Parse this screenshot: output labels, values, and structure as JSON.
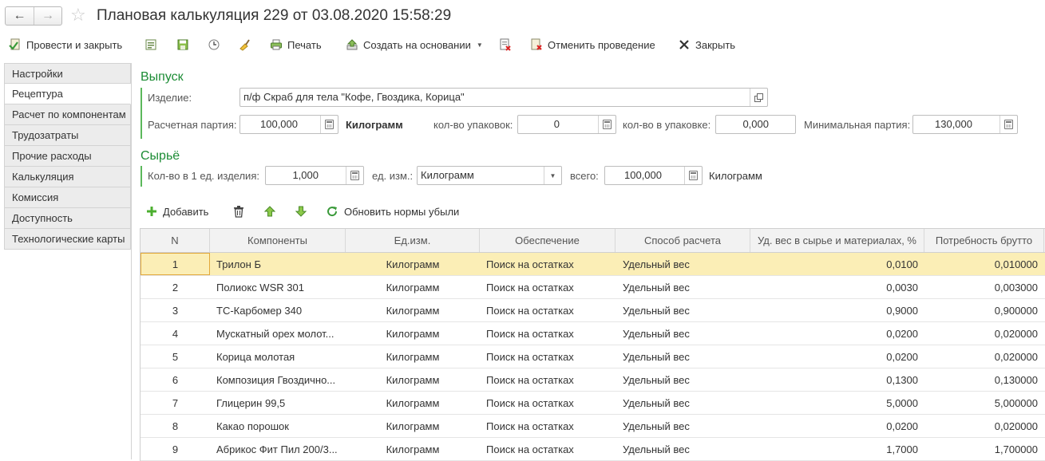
{
  "window": {
    "title": "Плановая калькуляция 229 от 03.08.2020 15:58:29",
    "back_glyph": "←",
    "forward_glyph": "→",
    "star_glyph": "☆"
  },
  "toolbar": {
    "post_close": "Провести и закрыть",
    "print": "Печать",
    "create_based": "Создать на основании",
    "cancel_post": "Отменить проведение",
    "close": "Закрыть"
  },
  "sidenav": {
    "items": [
      {
        "label": "Настройки",
        "active": false
      },
      {
        "label": "Рецептура",
        "active": true
      },
      {
        "label": "Расчет по компонентам",
        "active": false
      },
      {
        "label": "Трудозатраты",
        "active": false
      },
      {
        "label": "Прочие расходы",
        "active": false
      },
      {
        "label": "Калькуляция",
        "active": false
      },
      {
        "label": "Комиссия",
        "active": false
      },
      {
        "label": "Доступность",
        "active": false
      },
      {
        "label": "Технологические карты",
        "active": false
      }
    ]
  },
  "output": {
    "section_title": "Выпуск",
    "product_label": "Изделие:",
    "product_value": "п/ф Скраб для тела \"Кофе, Гвоздика, Корица\"",
    "batch_label": "Расчетная партия:",
    "batch_value": "100,000",
    "batch_unit": "Килограмм",
    "packs_label": "кол-во упаковок:",
    "packs_value": "0",
    "per_pack_label": "кол-во в упаковке:",
    "per_pack_value": "0,000",
    "min_batch_label": "Минимальная партия:",
    "min_batch_value": "130,000"
  },
  "raw": {
    "section_title": "Сырьё",
    "qty_label": "Кол-во в 1 ед. изделия:",
    "qty_value": "1,000",
    "unit_label": "ед. изм.:",
    "unit_value": "Килограмм",
    "total_label": "всего:",
    "total_value": "100,000",
    "total_unit": "Килограмм"
  },
  "table_toolbar": {
    "add": "Добавить",
    "refresh_loss": "Обновить нормы убыли"
  },
  "table": {
    "headers": [
      "N",
      "Компоненты",
      "Ед.изм.",
      "Обеспечение",
      "Способ расчета",
      "Уд. вес в сырье и материалах, %",
      "Потребность брутто"
    ],
    "rows": [
      {
        "n": "1",
        "comp": "Трилон Б",
        "unit": "Килограмм",
        "prov": "Поиск на остатках",
        "meth": "Удельный вес",
        "wt": "0,0100",
        "need": "0,010000"
      },
      {
        "n": "2",
        "comp": "Полиокс WSR 301",
        "unit": "Килограмм",
        "prov": "Поиск на остатках",
        "meth": "Удельный вес",
        "wt": "0,0030",
        "need": "0,003000"
      },
      {
        "n": "3",
        "comp": "ТС-Карбомер 340",
        "unit": "Килограмм",
        "prov": "Поиск на остатках",
        "meth": "Удельный вес",
        "wt": "0,9000",
        "need": "0,900000"
      },
      {
        "n": "4",
        "comp": "Мускатный орех молот...",
        "unit": "Килограмм",
        "prov": "Поиск на остатках",
        "meth": "Удельный вес",
        "wt": "0,0200",
        "need": "0,020000"
      },
      {
        "n": "5",
        "comp": "Корица молотая",
        "unit": "Килограмм",
        "prov": "Поиск на остатках",
        "meth": "Удельный вес",
        "wt": "0,0200",
        "need": "0,020000"
      },
      {
        "n": "6",
        "comp": "Композиция Гвоздично...",
        "unit": "Килограмм",
        "prov": "Поиск на остатках",
        "meth": "Удельный вес",
        "wt": "0,1300",
        "need": "0,130000"
      },
      {
        "n": "7",
        "comp": "Глицерин 99,5",
        "unit": "Килограмм",
        "prov": "Поиск на остатках",
        "meth": "Удельный вес",
        "wt": "5,0000",
        "need": "5,000000"
      },
      {
        "n": "8",
        "comp": "Какао порошок",
        "unit": "Килограмм",
        "prov": "Поиск на остатках",
        "meth": "Удельный вес",
        "wt": "0,0200",
        "need": "0,020000"
      },
      {
        "n": "9",
        "comp": "Абрикос Фит Пил 200/3...",
        "unit": "Килограмм",
        "prov": "Поиск на остатках",
        "meth": "Удельный вес",
        "wt": "1,7000",
        "need": "1,700000"
      }
    ]
  },
  "colors": {
    "section_green": "#1c8c35",
    "selected_row": "#fbeeb6",
    "selected_border": "#e2a83a"
  }
}
